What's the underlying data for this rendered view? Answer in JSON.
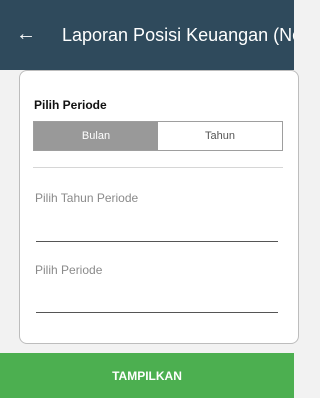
{
  "header": {
    "back_icon": "arrow-left-icon",
    "title": "Laporan Posisi Keuangan (Neraca)"
  },
  "form": {
    "period_label": "Pilih Periode",
    "segments": [
      {
        "label": "Bulan",
        "selected": true
      },
      {
        "label": "Tahun",
        "selected": false
      }
    ],
    "year_field_placeholder": "Pilih Tahun Periode",
    "period_field_placeholder": "Pilih Periode"
  },
  "actions": {
    "submit_label": "TAMPILKAN"
  },
  "colors": {
    "appbar": "#2f4a5c",
    "segment_active": "#999999",
    "button": "#4caf50"
  }
}
